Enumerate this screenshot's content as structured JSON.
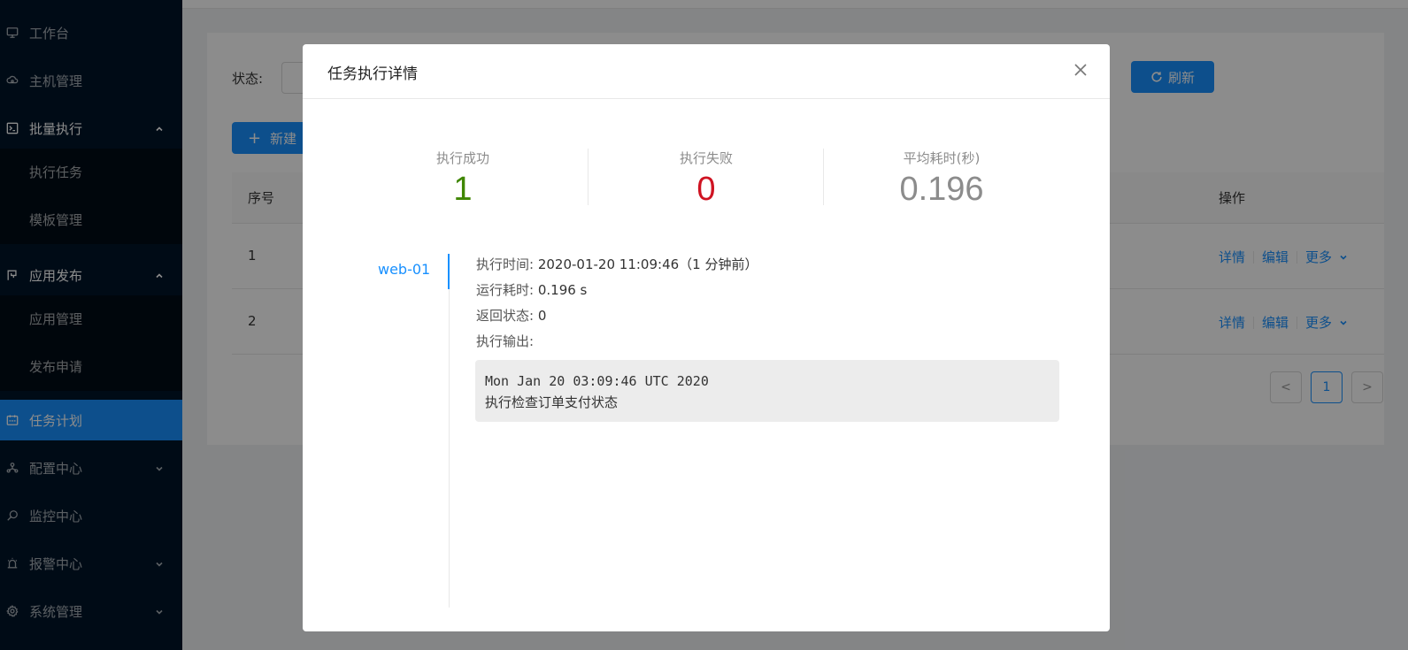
{
  "sidebar": {
    "items": [
      {
        "label": "工作台",
        "icon": "desktop-icon"
      },
      {
        "label": "主机管理",
        "icon": "cloud-server-icon"
      },
      {
        "label": "批量执行",
        "icon": "terminal-icon",
        "expanded": true,
        "children": [
          {
            "label": "执行任务"
          },
          {
            "label": "模板管理"
          }
        ]
      },
      {
        "label": "应用发布",
        "icon": "deploy-flag-icon",
        "expanded": true,
        "children": [
          {
            "label": "应用管理"
          },
          {
            "label": "发布申请"
          }
        ]
      },
      {
        "label": "任务计划",
        "icon": "schedule-icon",
        "selected": true
      },
      {
        "label": "配置中心",
        "icon": "cluster-icon"
      },
      {
        "label": "监控中心",
        "icon": "monitor-search-icon"
      },
      {
        "label": "报警中心",
        "icon": "alarm-icon"
      },
      {
        "label": "系统管理",
        "icon": "setting-icon"
      }
    ]
  },
  "page": {
    "filter_label": "状态:",
    "new_button": "新建",
    "refresh_button": "刷新",
    "table": {
      "headers": [
        "序号",
        "操作"
      ],
      "rows": [
        {
          "no": "1",
          "actions": [
            "详情",
            "编辑",
            "更多"
          ]
        },
        {
          "no": "2",
          "actions": [
            "详情",
            "编辑",
            "更多"
          ]
        }
      ]
    },
    "pagination": {
      "prev": "<",
      "current": "1",
      "next": ">"
    }
  },
  "modal": {
    "title": "任务执行详情",
    "stats": [
      {
        "label": "执行成功",
        "value": "1",
        "color": "#3f8600"
      },
      {
        "label": "执行失败",
        "value": "0",
        "color": "#cf1322"
      },
      {
        "label": "平均耗时(秒)",
        "value": "0.196",
        "color": "#8c8c8c"
      }
    ],
    "host": "web-01",
    "details": {
      "exec_time_label": "执行时间:",
      "exec_time_value": "2020-01-20 11:09:46（1 分钟前）",
      "duration_label": "运行耗时:",
      "duration_value": "0.196 s",
      "code_label": "返回状态:",
      "code_value": "0",
      "output_label": "执行输出:"
    },
    "output_lines": [
      "Mon Jan 20 03:09:46 UTC 2020",
      "执行检查订单支付状态"
    ]
  },
  "colors": {
    "primary": "#1890ff",
    "sidebar_bg": "#001529",
    "success": "#3f8600",
    "danger": "#cf1322"
  }
}
